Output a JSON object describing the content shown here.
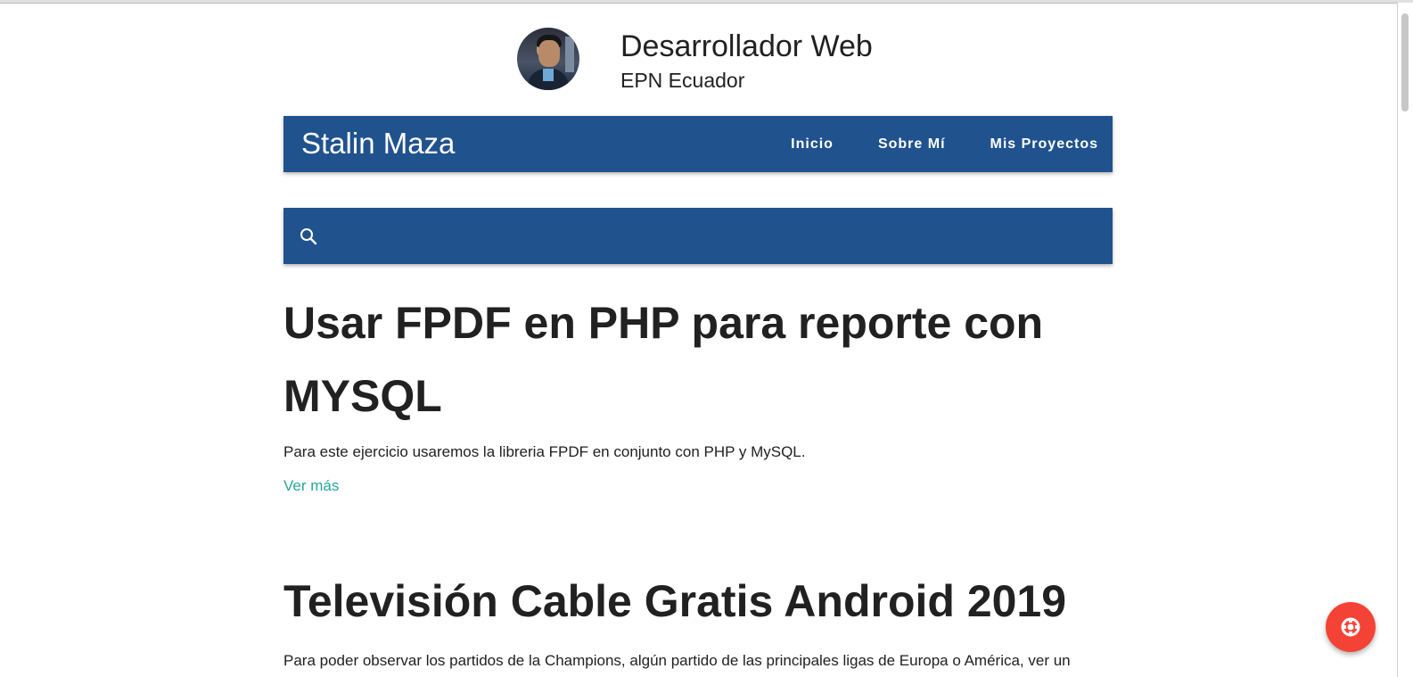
{
  "profile": {
    "title": "Desarrollador Web",
    "subtitle": "EPN Ecuador",
    "avatar_icon": "avatar-photo"
  },
  "navbar": {
    "brand": "Stalin Maza",
    "links": [
      "Inicio",
      "Sobre Mí",
      "Mis Proyectos"
    ],
    "color": "#20528e"
  },
  "search": {
    "icon": "search-icon",
    "value": "",
    "placeholder": ""
  },
  "posts": [
    {
      "title": "Usar FPDF en PHP para reporte con MYSQL",
      "excerpt": "Para este ejercicio usaremos la libreria FPDF en conjunto con PHP y MySQL.",
      "link": "Ver más"
    },
    {
      "title": "Televisión Cable Gratis Android 2019",
      "excerpt": "Para poder observar los partidos de la Champions, algún partido de las principales ligas de Europa o América, ver un"
    }
  ],
  "fab": {
    "icon": "lifebuoy-icon",
    "color": "#f44336"
  },
  "accent_link_color": "#26a69a"
}
